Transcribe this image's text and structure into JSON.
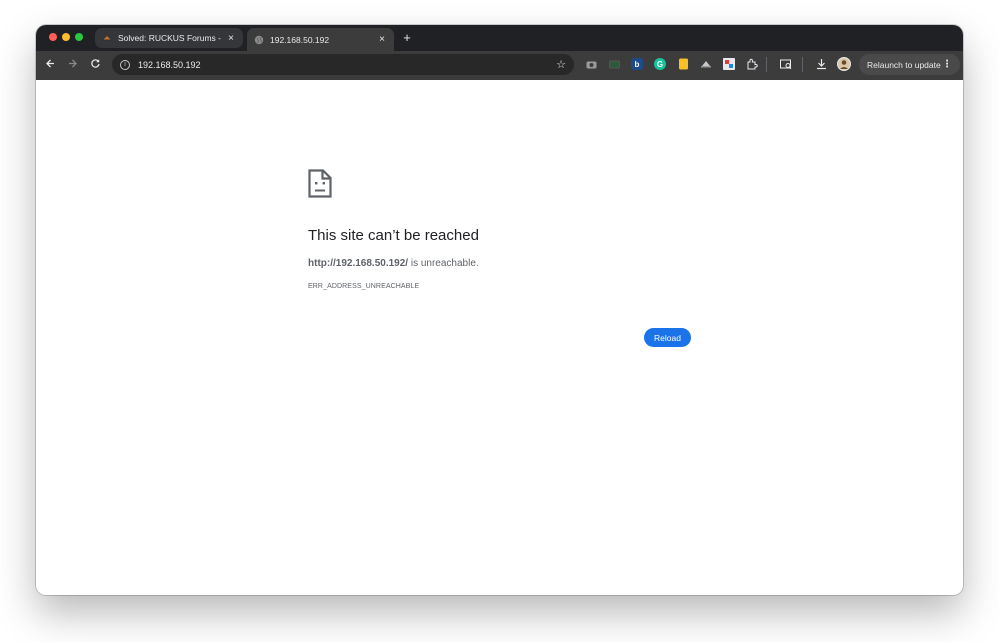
{
  "browser": {
    "tabs": [
      {
        "title": "Solved: RUCKUS Forums - Re",
        "favicon": "ruckus-hat-icon",
        "active": false
      },
      {
        "title": "192.168.50.192",
        "favicon": "globe-icon",
        "active": true
      }
    ],
    "new_tab_label": "+",
    "close_tab_glyph": "×",
    "address_bar": {
      "url": "192.168.50.192"
    },
    "extensions": [
      "camera-icon",
      "screen-icon",
      "bitdefender-icon",
      "grammarly-icon",
      "notes-icon",
      "hat-icon",
      "film-icon",
      "puzzle-icon",
      "tab-search-icon",
      "download-icon",
      "profile-avatar"
    ],
    "relaunch_label": "Relaunch to update",
    "colors": {
      "tabstrip": "#202124",
      "toolbar": "#3c3c3c",
      "accent": "#1a73e8"
    }
  },
  "error_page": {
    "title": "This site can’t be reached",
    "url": "http://192.168.50.192/",
    "description_suffix": " is unreachable.",
    "error_code": "ERR_ADDRESS_UNREACHABLE",
    "reload_label": "Reload"
  }
}
